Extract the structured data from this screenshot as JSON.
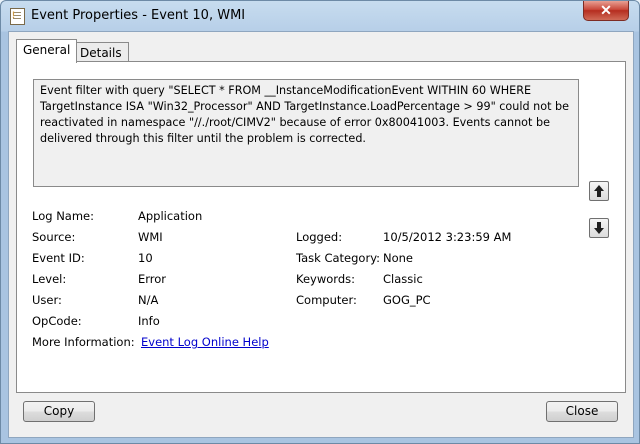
{
  "window": {
    "title": "Event Properties - Event 10, WMI",
    "close_glyph": "✕"
  },
  "tabs": [
    {
      "label": "General"
    },
    {
      "label": "Details"
    }
  ],
  "description": "Event filter with query \"SELECT * FROM __InstanceModificationEvent WITHIN 60 WHERE TargetInstance ISA \"Win32_Processor\" AND TargetInstance.LoadPercentage > 99\" could not be reactivated in namespace \"//./root/CIMV2\" because of error 0x80041003. Events cannot be delivered through this filter until the problem is corrected.",
  "fields": {
    "log_name": {
      "label": "Log Name:",
      "value": "Application"
    },
    "source": {
      "label": "Source:",
      "value": "WMI"
    },
    "event_id": {
      "label": "Event ID:",
      "value": "10"
    },
    "level": {
      "label": "Level:",
      "value": "Error"
    },
    "user": {
      "label": "User:",
      "value": "N/A"
    },
    "opcode": {
      "label": "OpCode:",
      "value": "Info"
    },
    "more_info": {
      "label": "More Information:",
      "value": "Event Log Online Help"
    },
    "logged": {
      "label": "Logged:",
      "value": "10/5/2012 3:23:59 AM"
    },
    "task_category": {
      "label": "Task Category:",
      "value": "None"
    },
    "keywords": {
      "label": "Keywords:",
      "value": "Classic"
    },
    "computer": {
      "label": "Computer:",
      "value": "GOG_PC"
    }
  },
  "buttons": {
    "copy": "Copy",
    "close": "Close"
  },
  "icons": {
    "up": "arrow-up-icon",
    "down": "arrow-down-icon"
  }
}
